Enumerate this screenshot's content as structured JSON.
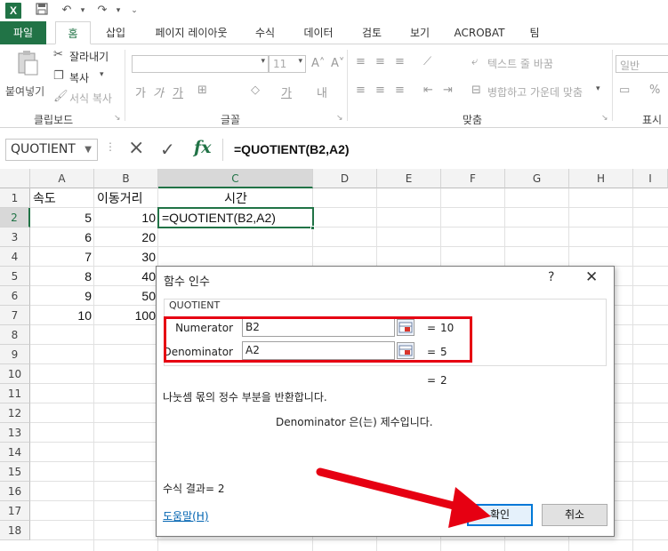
{
  "qat": {
    "logo": "X",
    "save_icon": "save-icon",
    "undo_icon": "undo-icon",
    "redo_icon": "redo-icon"
  },
  "tabs": [
    "파일",
    "홈",
    "삽입",
    "페이지 레이아웃",
    "수식",
    "데이터",
    "검토",
    "보기",
    "ACROBAT",
    "팀"
  ],
  "ribbon": {
    "paste": "붙여넣기",
    "cut": "잘라내기",
    "copy": "복사",
    "format_painter": "서식 복사",
    "font_size": "11",
    "wrap_text": "텍스트 줄 바꿈",
    "merge_center": "병합하고 가운데 맞춤",
    "number_format": "일반",
    "groups": {
      "clipboard": "클립보드",
      "font": "글꼴",
      "alignment": "맞춤",
      "number": "표시"
    }
  },
  "formula_bar": {
    "name_box": "QUOTIENT",
    "cancel_icon": "×",
    "enter_icon": "✓",
    "fx": "fx",
    "formula": "=QUOTIENT(B2,A2)"
  },
  "grid": {
    "columns": [
      "A",
      "B",
      "C",
      "D",
      "E",
      "F",
      "G",
      "H",
      "I"
    ],
    "rows": [
      "1",
      "2",
      "3",
      "4",
      "5",
      "6",
      "7",
      "8",
      "9",
      "10",
      "11",
      "12",
      "13",
      "14",
      "15",
      "16",
      "17",
      "18"
    ],
    "headers": {
      "a1": "속도",
      "b1": "이동거리",
      "c1": "시간"
    },
    "a_values": [
      "5",
      "6",
      "7",
      "8",
      "9",
      "10"
    ],
    "b_values": [
      "10",
      "20",
      "30",
      "40",
      "50",
      "100"
    ],
    "c2": "=QUOTIENT(B2,A2)"
  },
  "dialog": {
    "title": "함수 인수",
    "help": "?",
    "close": "✕",
    "function_name": "QUOTIENT",
    "args": [
      {
        "label": "Numerator",
        "value": "B2",
        "result": "10"
      },
      {
        "label": "Denominator",
        "value": "A2",
        "result": "5"
      }
    ],
    "eq": "=",
    "result": "2",
    "description": "나눗셈 몫의 정수 부분을 반환합니다.",
    "arg_description": "Denominator  은(는) 제수입니다.",
    "formula_result": "수식 결과=  2",
    "help_link": "도움말(H)",
    "ok": "확인",
    "cancel": "취소"
  },
  "colors": {
    "excel_green": "#217346",
    "highlight_red": "#e60012",
    "link_blue": "#0063b1"
  }
}
